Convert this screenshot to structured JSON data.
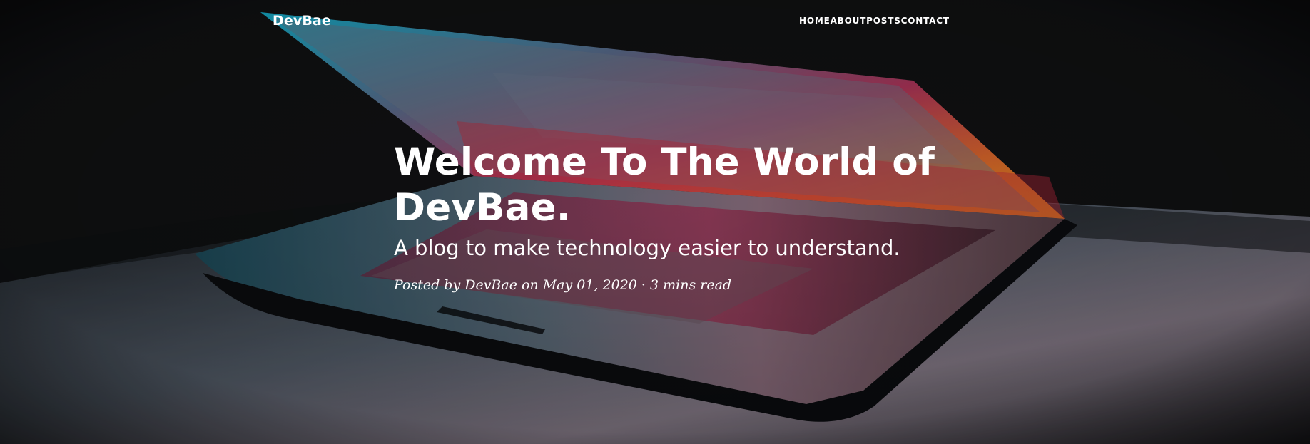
{
  "navbar": {
    "brand": "DevBae",
    "items": [
      {
        "label": "HOME"
      },
      {
        "label": "ABOUT"
      },
      {
        "label": "POSTS"
      },
      {
        "label": "CONTACT"
      }
    ]
  },
  "hero": {
    "title": "Welcome To The World of DevBae.",
    "subtitle": "A blog to make technology easier to understand.",
    "meta": "Posted by DevBae on May 01, 2020 · 3 mins read"
  }
}
